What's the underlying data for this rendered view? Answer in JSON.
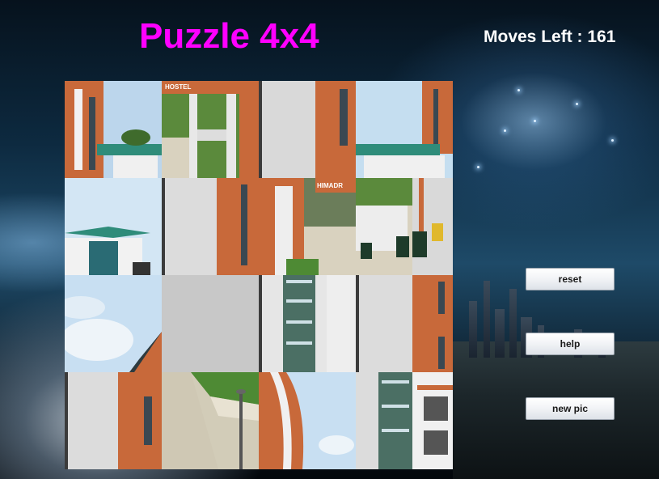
{
  "title": "Puzzle 4x4",
  "moves": {
    "text": "Moves Left : 161",
    "value": 161
  },
  "buttons": {
    "reset": "reset",
    "help": "help",
    "new_pic": "new pic"
  },
  "board": {
    "size": 4,
    "blank_tile": {
      "row": 2,
      "col": 1
    },
    "tile_color": "#c8c8c8",
    "image_fragments": [
      [
        "building-edge-sky",
        "hostel-gate",
        "white-pillar-orange-wall",
        "roof-canopy-sky"
      ],
      [
        "tower-rooftop-sky",
        "white-pillar-orange-wall",
        "himadri-sign-courtyard",
        "steps-dustbins"
      ],
      [
        "sky-clouds",
        "blank",
        "glass-facade",
        "orange-wall-column"
      ],
      [
        "white-pillar-orange-wall",
        "pathway-lawn",
        "curved-building-sky",
        "glass-facade-balconies"
      ]
    ]
  },
  "colors": {
    "title": "#ff00ff",
    "moves_text": "#ffffff"
  }
}
